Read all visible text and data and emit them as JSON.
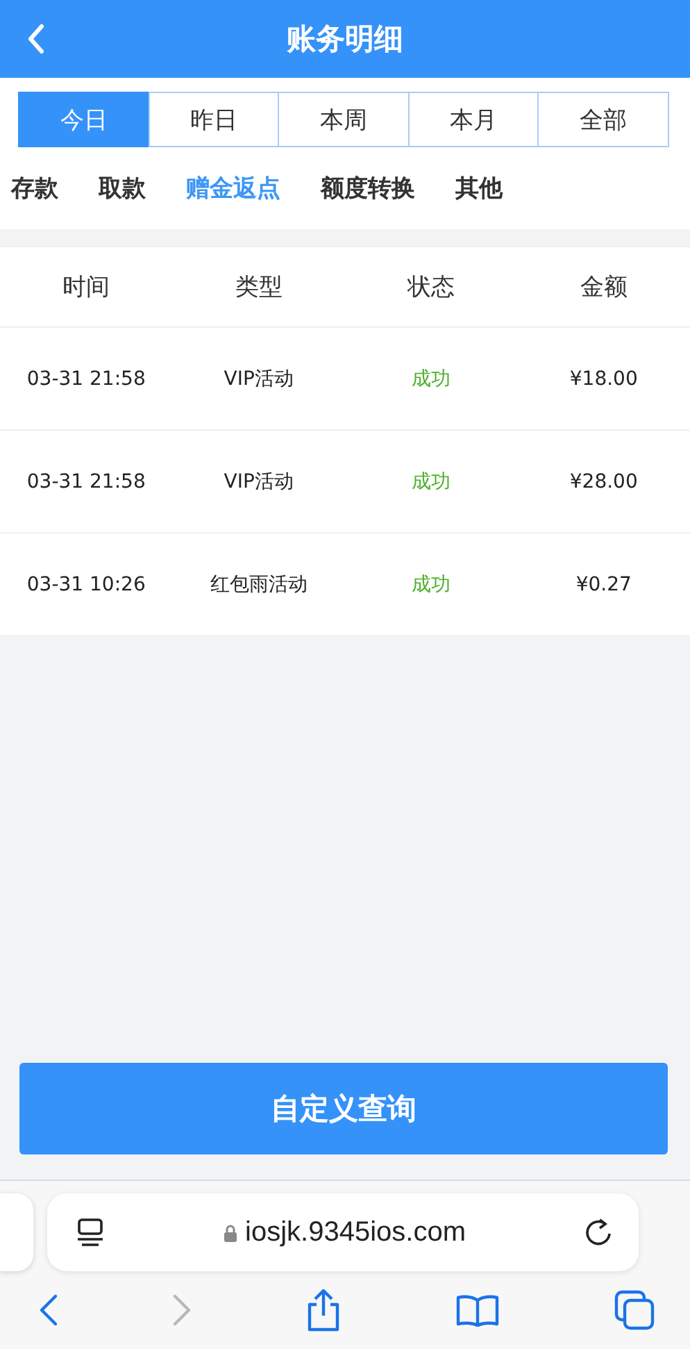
{
  "header": {
    "title": "账务明细"
  },
  "periods": [
    {
      "label": "今日",
      "selected": true
    },
    {
      "label": "昨日",
      "selected": false
    },
    {
      "label": "本周",
      "selected": false
    },
    {
      "label": "本月",
      "selected": false
    },
    {
      "label": "全部",
      "selected": false
    }
  ],
  "categories": [
    {
      "label": "存款",
      "selected": false
    },
    {
      "label": "取款",
      "selected": false
    },
    {
      "label": "赠金返点",
      "selected": true
    },
    {
      "label": "额度转换",
      "selected": false
    },
    {
      "label": "其他",
      "selected": false
    }
  ],
  "table": {
    "columns": [
      "时间",
      "类型",
      "状态",
      "金额"
    ],
    "rows": [
      {
        "time": "03-31 21:58",
        "type": "VIP活动",
        "status": "成功",
        "amount": "¥18.00"
      },
      {
        "time": "03-31 21:58",
        "type": "VIP活动",
        "status": "成功",
        "amount": "¥28.00"
      },
      {
        "time": "03-31 10:26",
        "type": "红包雨活动",
        "status": "成功",
        "amount": "¥0.27"
      }
    ]
  },
  "query_button": "自定义查询",
  "browser": {
    "url": "iosjk.9345ios.com",
    "toolbar": [
      {
        "kind": "back",
        "disabled": false
      },
      {
        "kind": "forward",
        "disabled": true
      },
      {
        "kind": "share",
        "disabled": false
      },
      {
        "kind": "bookmarks",
        "disabled": false
      },
      {
        "kind": "tabs",
        "disabled": false
      }
    ]
  }
}
